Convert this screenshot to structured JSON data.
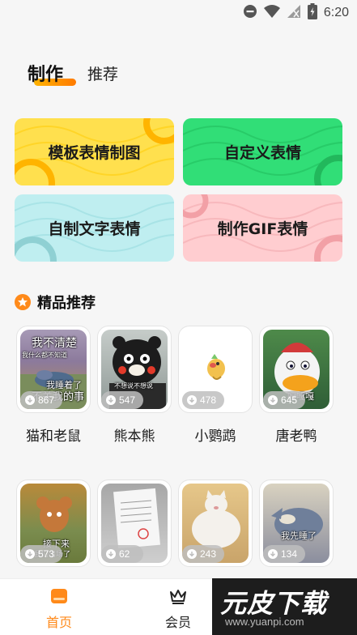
{
  "status_bar": {
    "time": "6:20",
    "icons": [
      "dnd-icon",
      "wifi-icon",
      "signal-off-icon",
      "battery-icon"
    ]
  },
  "tabs": [
    {
      "label": "制作",
      "active": true
    },
    {
      "label": "推荐",
      "active": false
    }
  ],
  "feature_cards": [
    {
      "label": "模板表情制图",
      "color": "#ffe04e"
    },
    {
      "label": "自定义表情",
      "color": "#31de77"
    },
    {
      "label": "自制文字表情",
      "color": "#bfeef0"
    },
    {
      "label": "制作GIF表情",
      "color": "#ffcdd0"
    }
  ],
  "section": {
    "title": "精品推荐",
    "icon": "star-badge-icon",
    "accent": "#ff8a1a"
  },
  "recommend_items": [
    {
      "name": "猫和老鼠",
      "downloads": "867",
      "caption_top": "我不清楚",
      "caption_sub": "我什么都不知道",
      "caption_mid": "我睡着了",
      "caption_bottom": "不关我的事"
    },
    {
      "name": "熊本熊",
      "downloads": "547",
      "caption_mid": "不想说不想说"
    },
    {
      "name": "小鹦鹉",
      "downloads": "478"
    },
    {
      "name": "唐老鸭",
      "downloads": "645",
      "caption_mid": "嘎嘎嘎"
    },
    {
      "name": "",
      "downloads": "573",
      "caption_mid": "接下来",
      "caption_bottom": "该我们出场了"
    },
    {
      "name": "",
      "downloads": "62"
    },
    {
      "name": "",
      "downloads": "243"
    },
    {
      "name": "",
      "downloads": "134",
      "caption_mid": "我先睡了"
    }
  ],
  "bottom_nav": [
    {
      "label": "首页",
      "icon": "home-icon",
      "active": true
    },
    {
      "label": "会员",
      "icon": "crown-icon",
      "active": false
    }
  ],
  "watermark": {
    "title": "元皮下载",
    "url": "www.yuanpi.com"
  }
}
